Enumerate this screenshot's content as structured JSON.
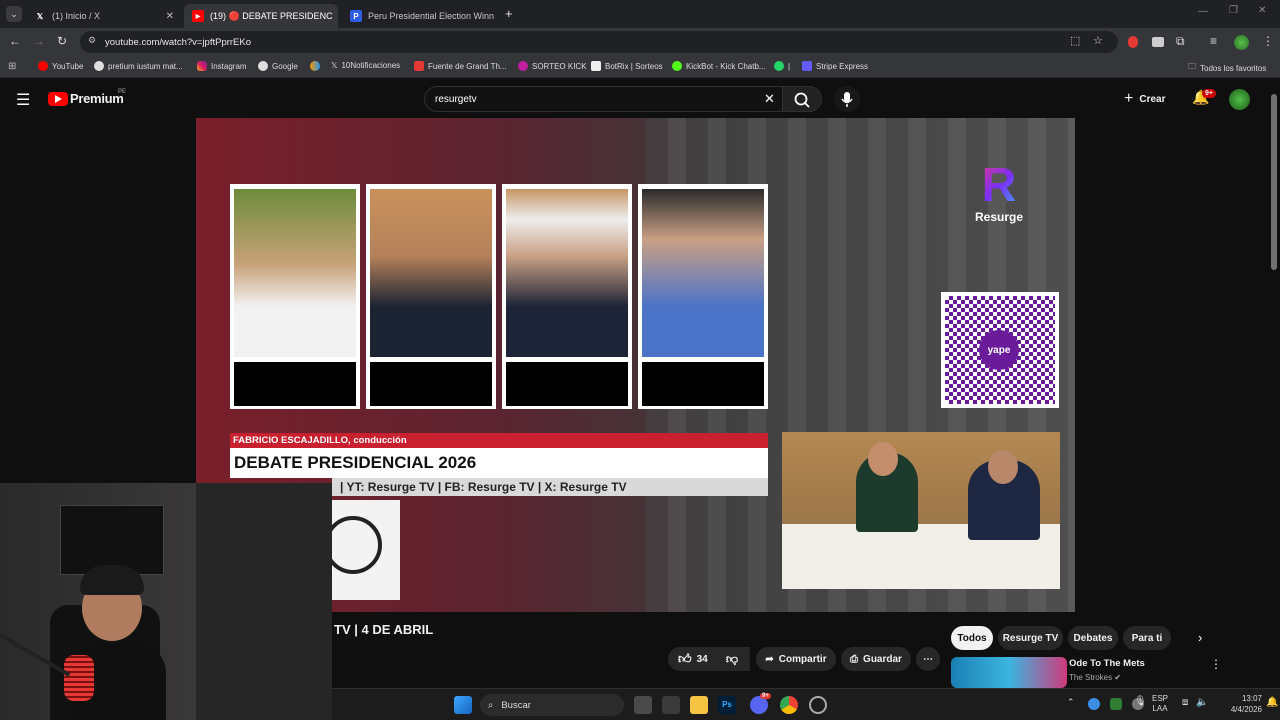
{
  "browser": {
    "tabs": [
      {
        "title": "(1) Inicio / X",
        "favicon": "x-logo-icon"
      },
      {
        "title": "(19) 🔴 DEBATE PRESIDENC",
        "favicon": "youtube-icon"
      },
      {
        "title": "Peru Presidential Election Winn",
        "favicon": "polymarket-icon"
      }
    ],
    "url": "youtube.com/watch?v=jpftPprrEKo",
    "bookmarks": [
      "YouTube",
      "pretium iustum mat...",
      "Instagram",
      "Google",
      "10Notificaciones",
      "Fuente de Grand Th...",
      "SORTEO KICK",
      "BotRix | Sorteos",
      "KickBot - Kick Chatb...",
      "|",
      "Stripe Express"
    ],
    "all_bookmarks": "Todos los favoritos"
  },
  "youtube": {
    "logo": "Premium",
    "region": "PE",
    "search_value": "resurgetv",
    "create_label": "Crear",
    "notif_badge": "9+"
  },
  "video": {
    "brand": "Resurge",
    "host_label": "FABRICIO ESCAJADILLO, conducción",
    "title": "DEBATE PRESIDENCIAL 2026",
    "ticker": "| YT: Resurge TV | FB: Resurge TV | X: Resurge TV",
    "qr_label": "yape"
  },
  "below": {
    "title_fragment": "TV | 4 DE ABRIL",
    "likes": "34",
    "share_label": "Compartir",
    "save_label": "Guardar",
    "chips": [
      "Todos",
      "Resurge TV",
      "Debates",
      "Para ti"
    ],
    "recommended": {
      "title": "Ode To The Mets",
      "channel": "The Strokes"
    }
  },
  "taskbar": {
    "search_placeholder": "Buscar",
    "lang": "ESP",
    "lang2": "LAA",
    "time": "13:07",
    "date": "4/4/2026",
    "discord_badge": "9+"
  },
  "colors": {
    "yt_red": "#ff0000",
    "accent_red": "#c8202f",
    "brand_purple": "#7b2ff7"
  }
}
